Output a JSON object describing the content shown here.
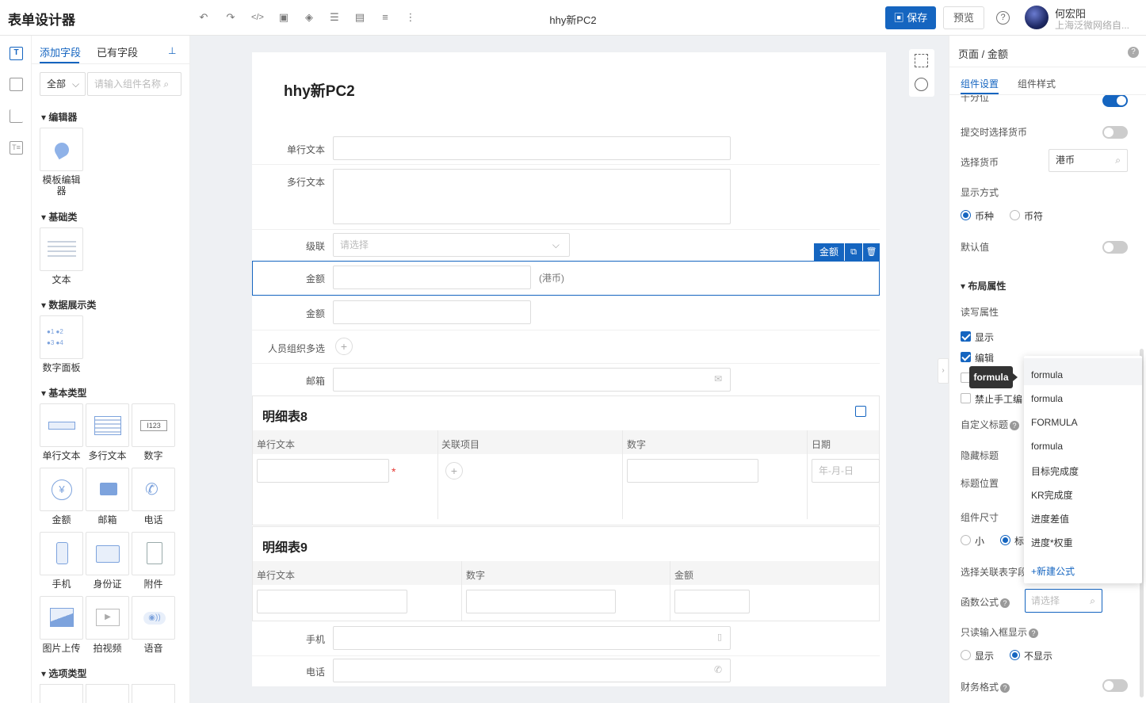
{
  "header": {
    "app_title": "表单设计器",
    "doc_title": "hhy新PC2",
    "save_label": "保存",
    "preview_label": "预览",
    "user_name": "何宏阳",
    "user_org": "上海泛微网络自..."
  },
  "left_panel": {
    "tabs": [
      "添加字段",
      "已有字段"
    ],
    "category": "全部",
    "search_placeholder": "请输入组件名称",
    "sections": {
      "editor": "编辑器",
      "basic": "基础类",
      "display": "数据展示类",
      "basic_types": "基本类型",
      "options": "选项类型"
    },
    "items": {
      "template_editor": "模板编辑器",
      "text": "文本",
      "num_panel": "数字面板",
      "single_text": "单行文本",
      "multi_text": "多行文本",
      "number": "数字",
      "amount": "金额",
      "email": "邮箱",
      "phone": "电话",
      "mobile": "手机",
      "id_card": "身份证",
      "attachment": "附件",
      "image_upload": "图片上传",
      "video": "拍视频",
      "voice": "语音"
    }
  },
  "form": {
    "title": "hhy新PC2",
    "fields": {
      "single_text": "单行文本",
      "multi_text": "多行文本",
      "cascade": "级联",
      "cascade_placeholder": "请选择",
      "amount1": "金额",
      "amount1_suffix": "(港币)",
      "amount2": "金额",
      "org_multi": "人员组织多选",
      "email": "邮箱",
      "mobile": "手机",
      "phone": "电话"
    },
    "selected_tag": "金额",
    "subtable8": {
      "title": "明细表8",
      "columns": [
        "单行文本",
        "关联项目",
        "数字",
        "日期"
      ],
      "date_placeholder": "年-月-日"
    },
    "subtable9": {
      "title": "明细表9",
      "columns": [
        "单行文本",
        "数字",
        "金额"
      ]
    }
  },
  "right_panel": {
    "breadcrumb_root": "页面",
    "breadcrumb_current": "金额",
    "tabs": [
      "组件设置",
      "组件样式"
    ],
    "thousand_sep": "千分位",
    "currency_on_submit": "提交时选择货币",
    "select_currency": "选择货币",
    "currency_value": "港币",
    "display_mode": "显示方式",
    "display_options": [
      "币种",
      "币符"
    ],
    "default_value": "默认值",
    "layout_section": "布局属性",
    "rw_attr": "读写属性",
    "show": "显示",
    "edit": "编辑",
    "no_manual": "禁止手工编",
    "custom_title": "自定义标题",
    "hide_title": "隐藏标题",
    "title_position": "标题位置",
    "comp_size": "组件尺寸",
    "size_small": "小",
    "size_std": "标",
    "select_related": "选择关联表字段",
    "func_formula": "函数公式",
    "func_placeholder": "请选择",
    "readonly_display": "只读输入框显示",
    "readonly_options": [
      "显示",
      "不显示"
    ],
    "finance_format": "财务格式"
  },
  "dropdown": {
    "items": [
      "formula",
      "formula",
      "FORMULA",
      "formula",
      "目标完成度",
      "KR完成度",
      "进度差值",
      "进度*权重"
    ],
    "new_formula": "+新建公式"
  },
  "tooltip": "formula"
}
